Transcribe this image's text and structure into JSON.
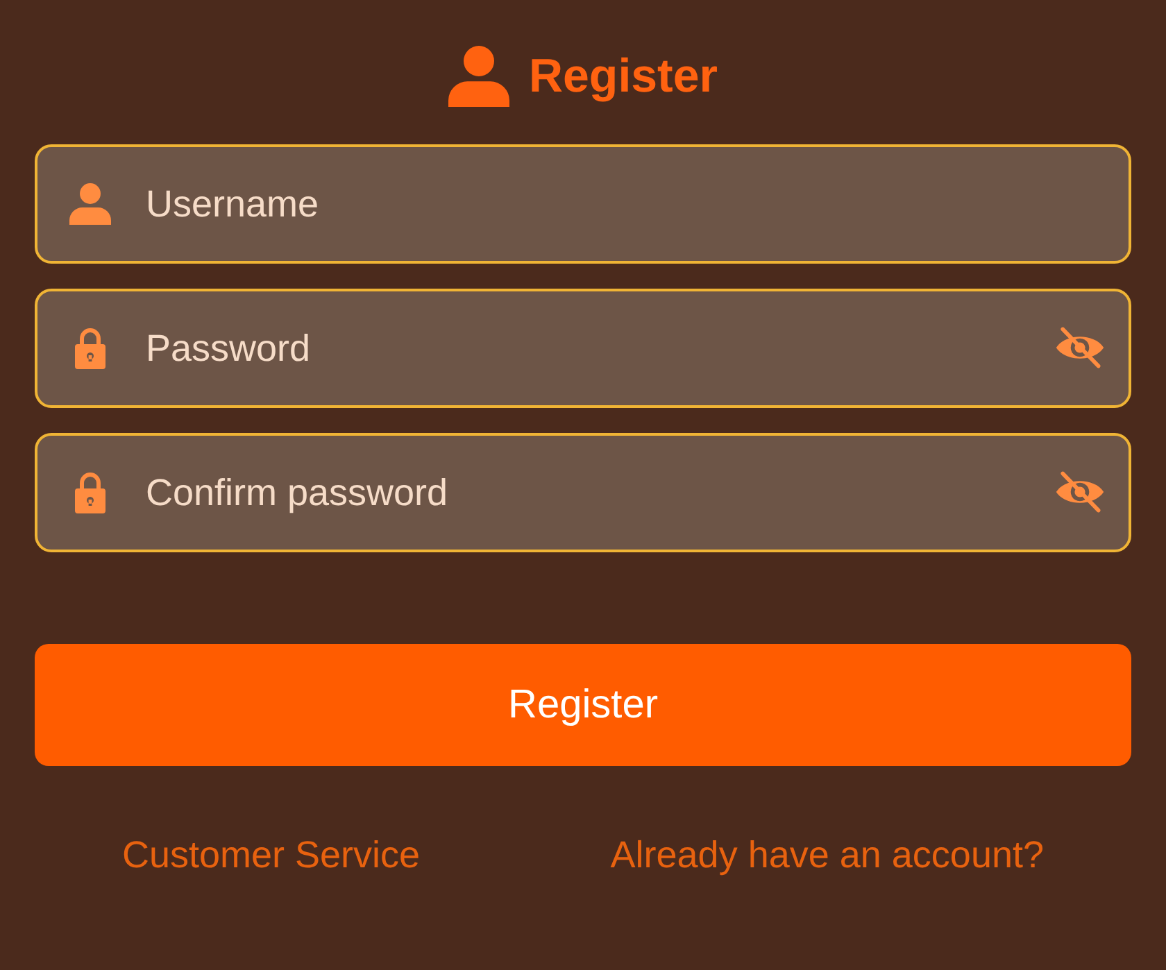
{
  "header": {
    "title": "Register"
  },
  "fields": [
    {
      "kind": "username",
      "placeholder": "Username"
    },
    {
      "kind": "password",
      "placeholder": "Password",
      "revealed": false
    },
    {
      "kind": "password",
      "placeholder": "Confirm password",
      "revealed": false
    }
  ],
  "submit": {
    "label": "Register"
  },
  "links": [
    "Customer Service",
    "Already have an account?"
  ]
}
